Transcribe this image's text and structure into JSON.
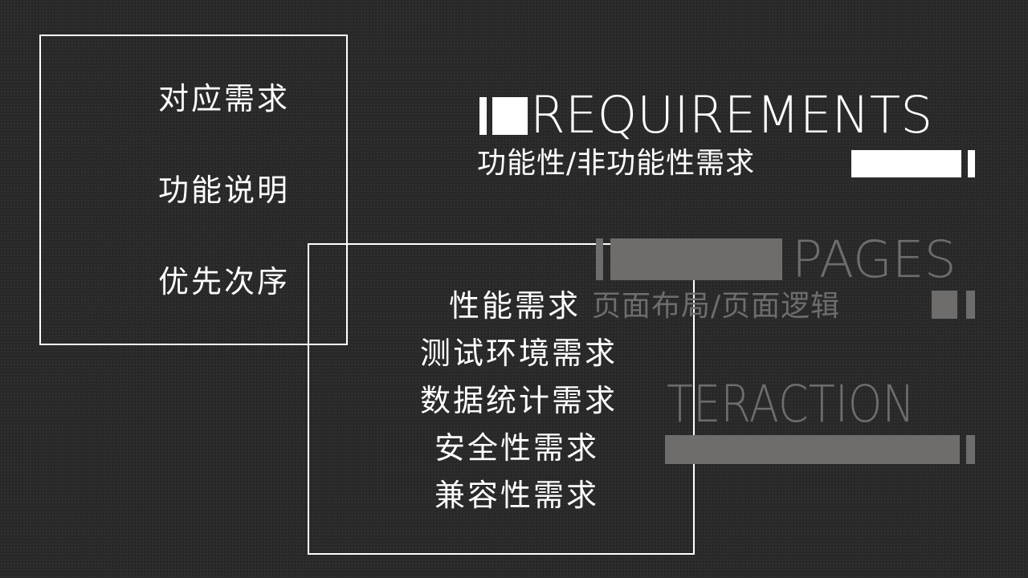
{
  "left_box": {
    "items": [
      "对应需求",
      "功能说明",
      "优先次序"
    ]
  },
  "right_box": {
    "items": [
      "性能需求",
      "测试环境需求",
      "数据统计需求",
      "安全性需求",
      "兼容性需求"
    ]
  },
  "sections": {
    "requirements": {
      "title": "REQUIREMENTS",
      "subtitle": "功能性/非功能性需求"
    },
    "pages": {
      "title": "PAGES",
      "subtitle": "页面布局/页面逻辑"
    },
    "interaction": {
      "title": "TERACTION"
    }
  },
  "colors": {
    "background": "#282828",
    "foreground": "#ffffff",
    "muted": "#6f6c6c"
  }
}
